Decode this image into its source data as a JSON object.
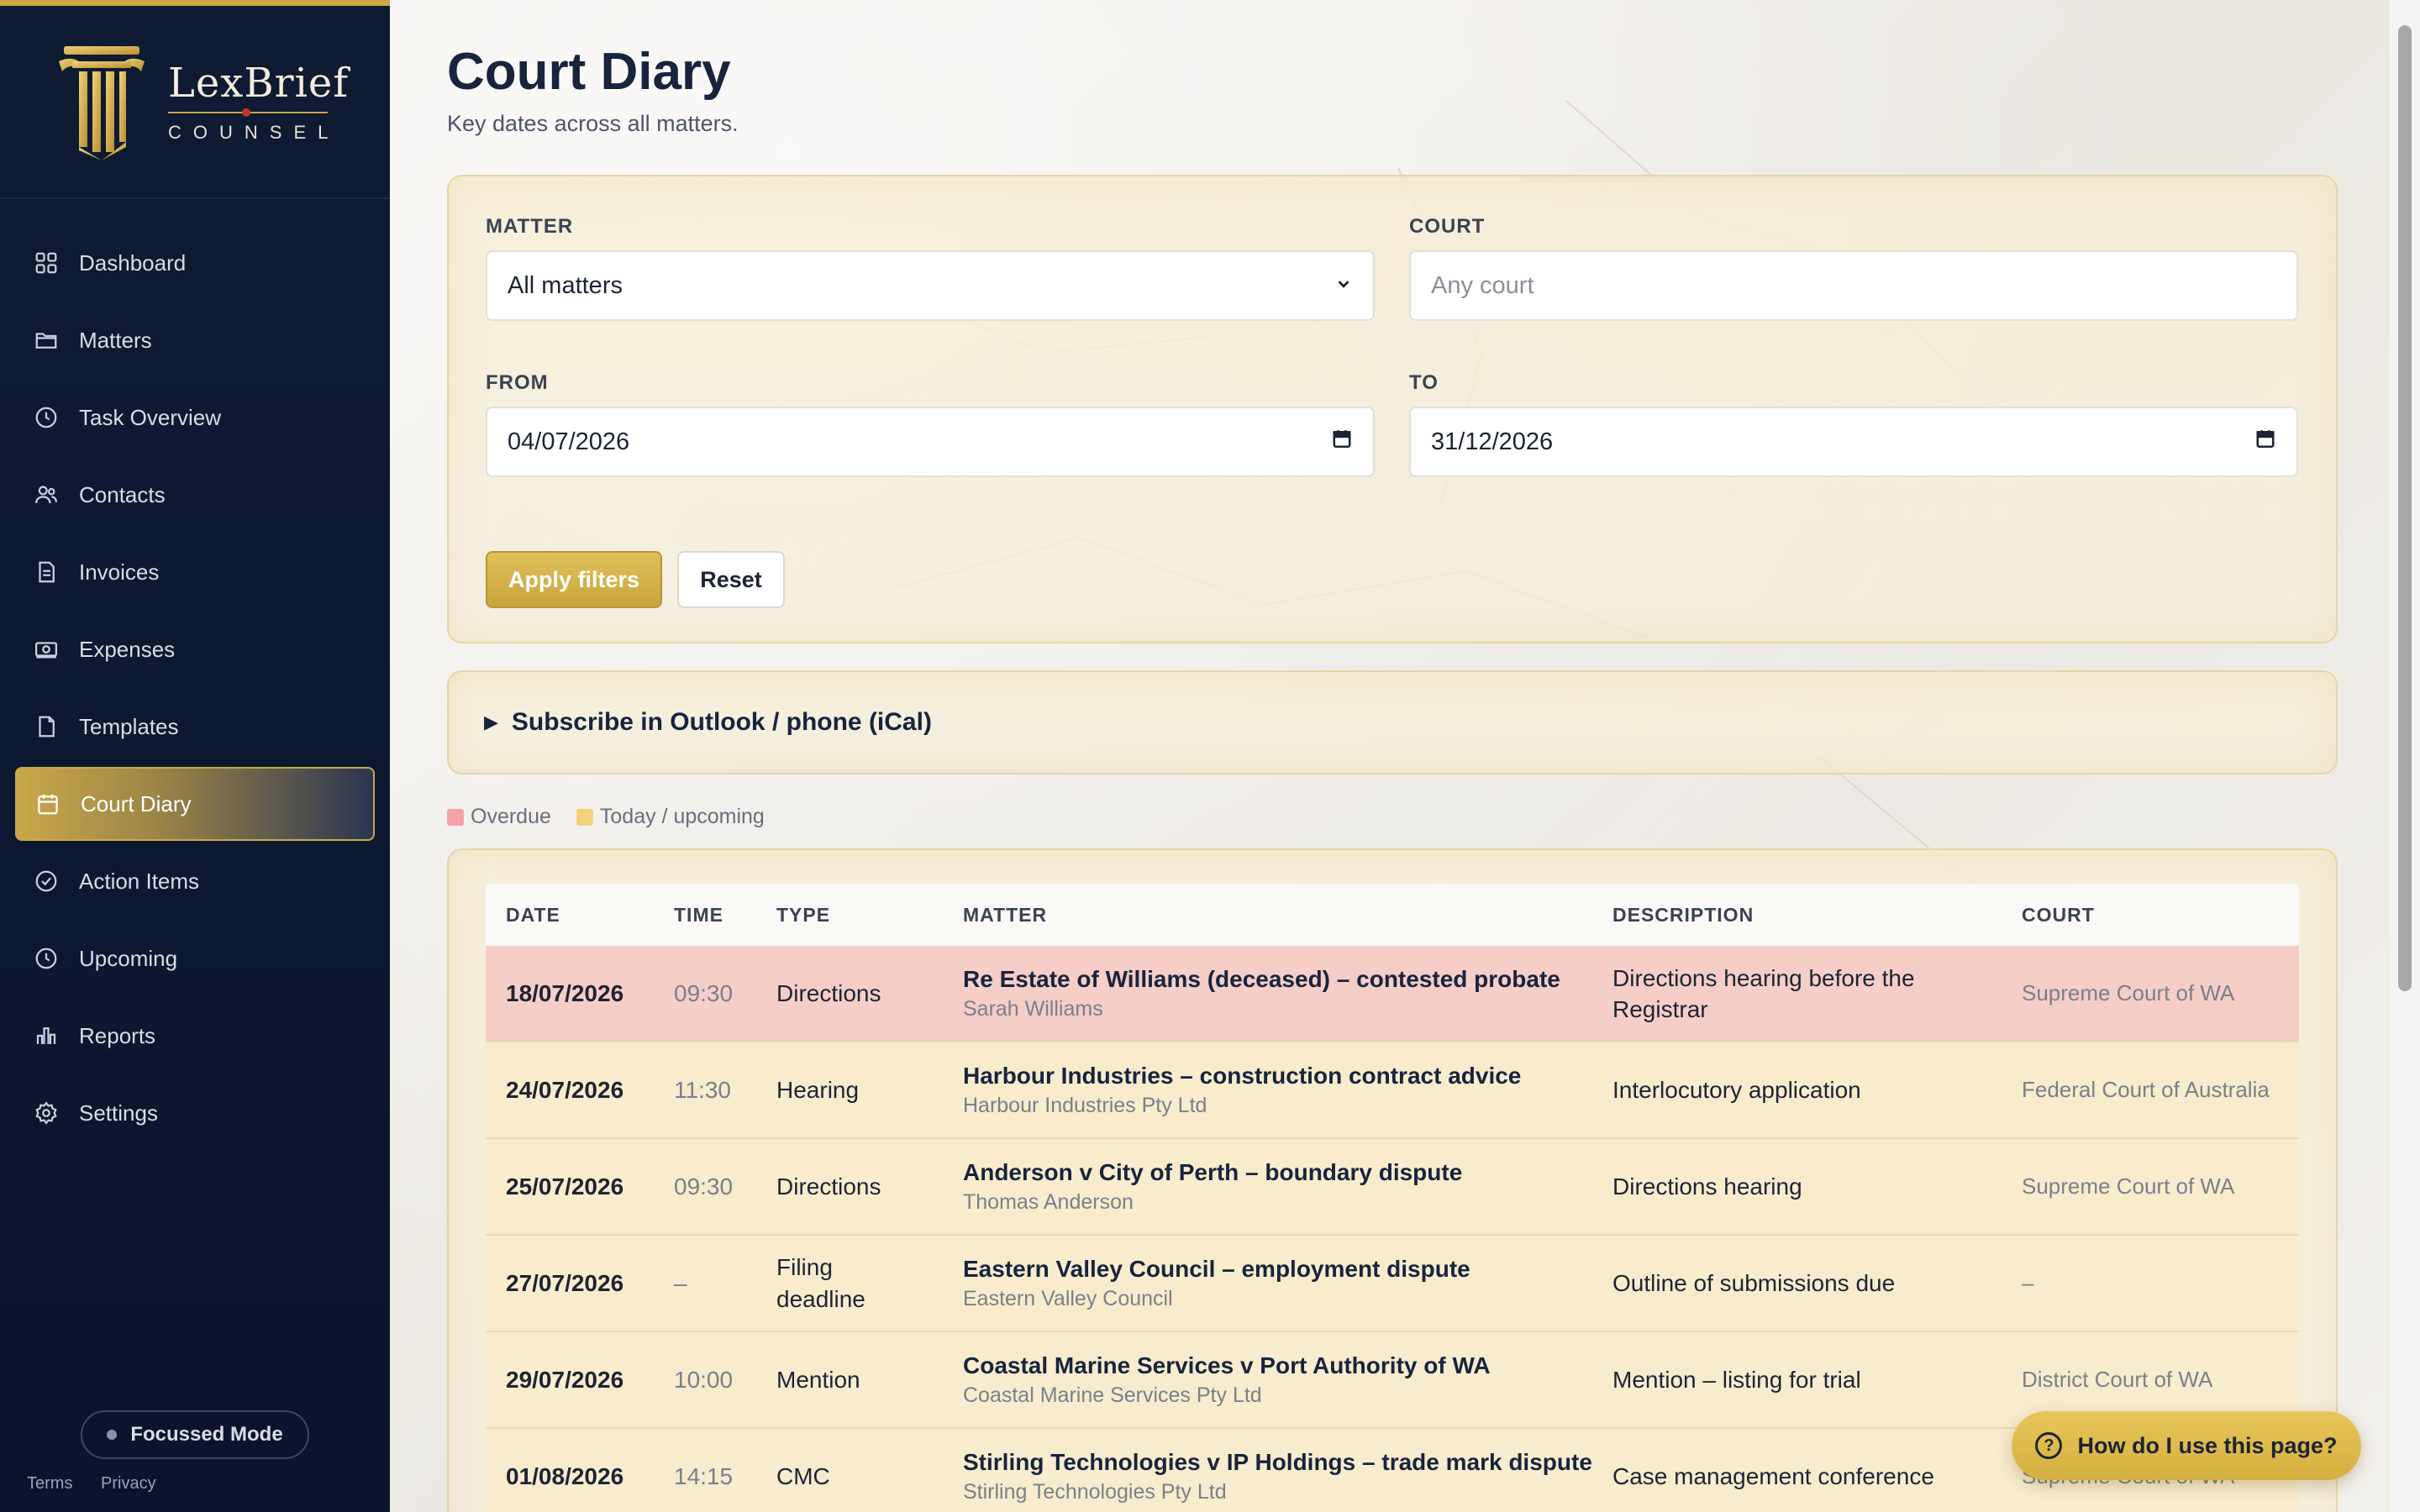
{
  "brand": {
    "name": "LexBrief",
    "sub": "COUNSEL"
  },
  "nav": [
    {
      "label": "Dashboard",
      "icon": "dashboard-grid-icon"
    },
    {
      "label": "Matters",
      "icon": "folder-icon"
    },
    {
      "label": "Task Overview",
      "icon": "clock-icon"
    },
    {
      "label": "Contacts",
      "icon": "people-icon"
    },
    {
      "label": "Invoices",
      "icon": "invoice-icon"
    },
    {
      "label": "Expenses",
      "icon": "money-icon"
    },
    {
      "label": "Templates",
      "icon": "document-icon"
    },
    {
      "label": "Court Diary",
      "icon": "calendar-icon",
      "active": true
    },
    {
      "label": "Action Items",
      "icon": "check-circle-icon"
    },
    {
      "label": "Upcoming",
      "icon": "clock-icon"
    },
    {
      "label": "Reports",
      "icon": "bar-chart-icon"
    },
    {
      "label": "Settings",
      "icon": "gear-icon"
    }
  ],
  "focus_mode": "Focussed Mode",
  "footer": {
    "terms": "Terms",
    "privacy": "Privacy"
  },
  "page": {
    "title": "Court Diary",
    "subtitle": "Key dates across all matters."
  },
  "filters": {
    "matter_label": "MATTER",
    "matter_value": "All matters",
    "court_label": "COURT",
    "court_placeholder": "Any court",
    "from_label": "FROM",
    "from_value": "04/07/2026",
    "to_label": "TO",
    "to_value": "31/12/2026",
    "apply": "Apply filters",
    "reset": "Reset"
  },
  "subscribe": "Subscribe in Outlook / phone (iCal)",
  "legend": {
    "overdue": "Overdue",
    "upcoming": "Today / upcoming",
    "overdue_color": "#f2a3a8",
    "upcoming_color": "#f3d37a"
  },
  "table": {
    "headers": [
      "DATE",
      "TIME",
      "TYPE",
      "MATTER",
      "DESCRIPTION",
      "COURT"
    ],
    "rows": [
      {
        "status": "overdue",
        "date": "18/07/2026",
        "time": "09:30",
        "type": "Directions",
        "matter": "Re Estate of Williams (deceased) – contested probate",
        "client": "Sarah Williams",
        "description": "Directions hearing before the Registrar",
        "court": "Supreme Court of WA"
      },
      {
        "status": "upcoming",
        "date": "24/07/2026",
        "time": "11:30",
        "type": "Hearing",
        "matter": "Harbour Industries – construction contract advice",
        "client": "Harbour Industries Pty Ltd",
        "description": "Interlocutory application",
        "court": "Federal Court of Australia"
      },
      {
        "status": "upcoming",
        "date": "25/07/2026",
        "time": "09:30",
        "type": "Directions",
        "matter": "Anderson v City of Perth – boundary dispute",
        "client": "Thomas Anderson",
        "description": "Directions hearing",
        "court": "Supreme Court of WA"
      },
      {
        "status": "upcoming",
        "date": "27/07/2026",
        "time": "–",
        "type": "Filing deadline",
        "matter": "Eastern Valley Council – employment dispute",
        "client": "Eastern Valley Council",
        "description": "Outline of submissions due",
        "court": "–"
      },
      {
        "status": "upcoming",
        "date": "29/07/2026",
        "time": "10:00",
        "type": "Mention",
        "matter": "Coastal Marine Services v Port Authority of WA",
        "client": "Coastal Marine Services Pty Ltd",
        "description": "Mention – listing for trial",
        "court": "District Court of WA"
      },
      {
        "status": "upcoming",
        "date": "01/08/2026",
        "time": "14:15",
        "type": "CMC",
        "matter": "Stirling Technologies v IP Holdings – trade mark dispute",
        "client": "Stirling Technologies Pty Ltd",
        "description": "Case management conference",
        "court": "Supreme Court of WA"
      }
    ]
  },
  "help": "How do I use this page?"
}
